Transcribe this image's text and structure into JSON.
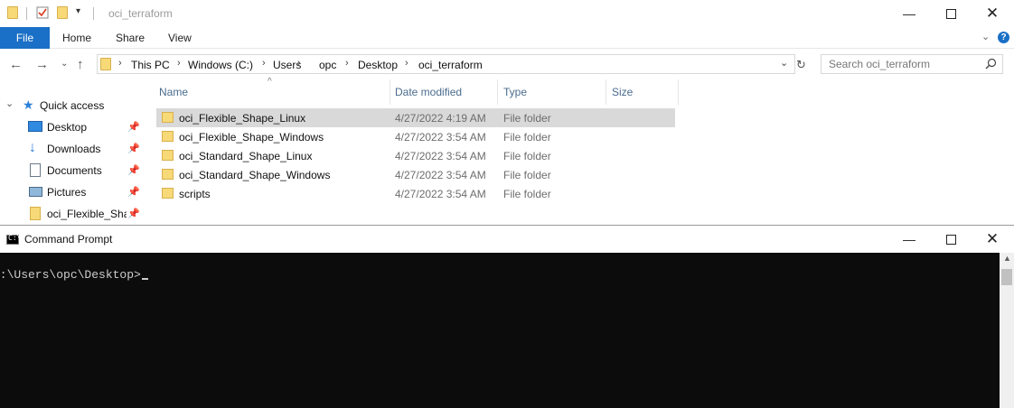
{
  "explorer": {
    "title": "oci_terraform",
    "ribbon_tabs": [
      "File",
      "Home",
      "Share",
      "View"
    ],
    "breadcrumbs": [
      "This PC",
      "Windows (C:)",
      "Users",
      "opc",
      "Desktop",
      "oci_terraform"
    ],
    "search_placeholder": "Search oci_terraform",
    "sidebar": {
      "quick_access": "Quick access",
      "items": [
        {
          "label": "Desktop",
          "icon": "desktop-icon",
          "pinned": true
        },
        {
          "label": "Downloads",
          "icon": "download-icon",
          "pinned": true
        },
        {
          "label": "Documents",
          "icon": "documents-icon",
          "pinned": true
        },
        {
          "label": "Pictures",
          "icon": "pictures-icon",
          "pinned": true
        },
        {
          "label": "oci_Flexible_Shap",
          "icon": "folder-icon",
          "pinned": true
        }
      ]
    },
    "columns": [
      "Name",
      "Date modified",
      "Type",
      "Size"
    ],
    "files": [
      {
        "name": "oci_Flexible_Shape_Linux",
        "date": "4/27/2022 4:19 AM",
        "type": "File folder",
        "selected": true
      },
      {
        "name": "oci_Flexible_Shape_Windows",
        "date": "4/27/2022 3:54 AM",
        "type": "File folder",
        "selected": false
      },
      {
        "name": "oci_Standard_Shape_Linux",
        "date": "4/27/2022 3:54 AM",
        "type": "File folder",
        "selected": false
      },
      {
        "name": "oci_Standard_Shape_Windows",
        "date": "4/27/2022 3:54 AM",
        "type": "File folder",
        "selected": false
      },
      {
        "name": "scripts",
        "date": "4/27/2022 3:54 AM",
        "type": "File folder",
        "selected": false
      }
    ]
  },
  "cmd": {
    "title": "Command Prompt",
    "prompt": "C:\\Users\\opc\\Desktop>"
  },
  "colors": {
    "file_tab": "#1a6fc6",
    "selection": "#d9d9d9",
    "console_bg": "#0c0c0c",
    "console_fg": "#cccccc",
    "header_text": "#4a6c8e"
  }
}
